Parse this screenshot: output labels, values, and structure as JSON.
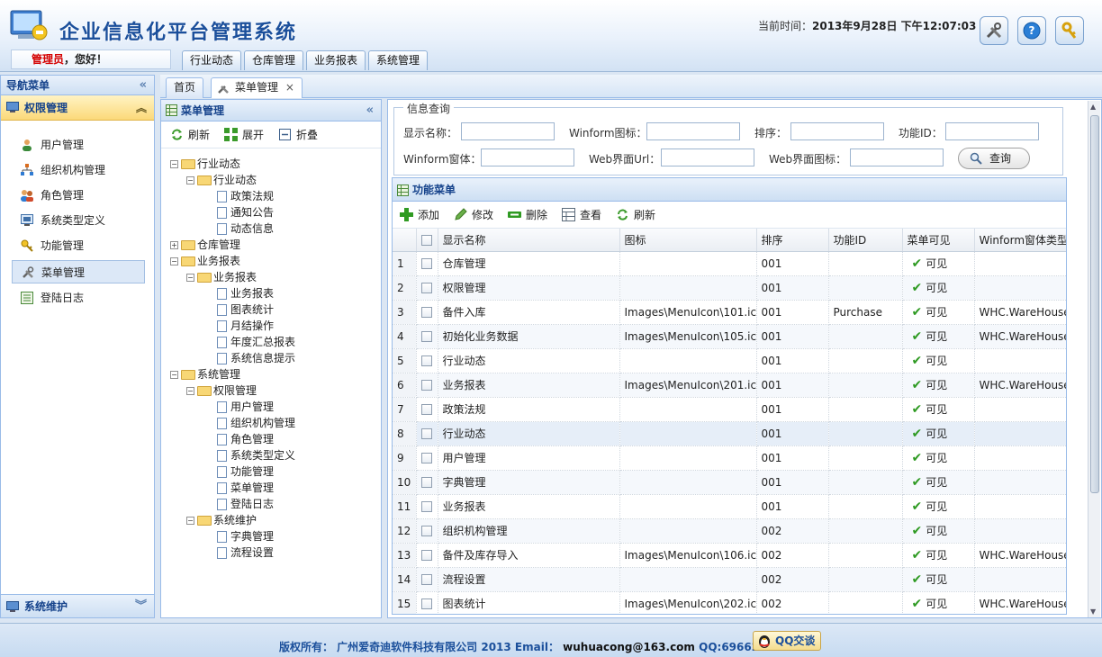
{
  "header": {
    "app_title": "企业信息化平台管理系统",
    "time_label": "当前时间：",
    "time_value": "2013年9月28日 下午12:07:03",
    "user_role": "管理员",
    "user_greeting": "，您好！",
    "top_tabs": [
      "行业动态",
      "仓库管理",
      "业务报表",
      "系统管理"
    ],
    "buttons": [
      {
        "name": "tools-icon"
      },
      {
        "name": "help-icon"
      },
      {
        "name": "exit-icon"
      }
    ]
  },
  "nav": {
    "title": "导航菜单",
    "section": "权限管理",
    "items": [
      {
        "label": "用户管理",
        "icon": "user-icon"
      },
      {
        "label": "组织机构管理",
        "icon": "org-icon"
      },
      {
        "label": "角色管理",
        "icon": "role-icon"
      },
      {
        "label": "系统类型定义",
        "icon": "system-type-icon"
      },
      {
        "label": "功能管理",
        "icon": "key-icon"
      },
      {
        "label": "菜单管理",
        "icon": "tools-icon",
        "selected": true
      },
      {
        "label": "登陆日志",
        "icon": "log-icon"
      }
    ],
    "bottom_section": "系统维护"
  },
  "workspace_tabs": [
    "首页",
    "菜单管理"
  ],
  "tree_panel": {
    "title": "菜单管理",
    "toolbar": [
      "刷新",
      "展开",
      "折叠"
    ],
    "nodes": [
      {
        "label": "行业动态",
        "level": 0,
        "type": "folder",
        "toggle": "-"
      },
      {
        "label": "行业动态",
        "level": 1,
        "type": "folder",
        "toggle": "-"
      },
      {
        "label": "政策法规",
        "level": 2,
        "type": "doc"
      },
      {
        "label": "通知公告",
        "level": 2,
        "type": "doc"
      },
      {
        "label": "动态信息",
        "level": 2,
        "type": "doc"
      },
      {
        "label": "仓库管理",
        "level": 0,
        "type": "folder",
        "toggle": "+"
      },
      {
        "label": "业务报表",
        "level": 0,
        "type": "folder",
        "toggle": "-"
      },
      {
        "label": "业务报表",
        "level": 1,
        "type": "folder",
        "toggle": "-"
      },
      {
        "label": "业务报表",
        "level": 2,
        "type": "doc"
      },
      {
        "label": "图表统计",
        "level": 2,
        "type": "doc"
      },
      {
        "label": "月结操作",
        "level": 2,
        "type": "doc"
      },
      {
        "label": "年度汇总报表",
        "level": 2,
        "type": "doc"
      },
      {
        "label": "系统信息提示",
        "level": 2,
        "type": "doc"
      },
      {
        "label": "系统管理",
        "level": 0,
        "type": "folder",
        "toggle": "-"
      },
      {
        "label": "权限管理",
        "level": 1,
        "type": "folder",
        "toggle": "-"
      },
      {
        "label": "用户管理",
        "level": 2,
        "type": "doc"
      },
      {
        "label": "组织机构管理",
        "level": 2,
        "type": "doc"
      },
      {
        "label": "角色管理",
        "level": 2,
        "type": "doc"
      },
      {
        "label": "系统类型定义",
        "level": 2,
        "type": "doc"
      },
      {
        "label": "功能管理",
        "level": 2,
        "type": "doc"
      },
      {
        "label": "菜单管理",
        "level": 2,
        "type": "doc"
      },
      {
        "label": "登陆日志",
        "level": 2,
        "type": "doc"
      },
      {
        "label": "系统维护",
        "level": 1,
        "type": "folder",
        "toggle": "-"
      },
      {
        "label": "字典管理",
        "level": 2,
        "type": "doc"
      },
      {
        "label": "流程设置",
        "level": 2,
        "type": "doc"
      }
    ]
  },
  "query": {
    "legend": "信息查询",
    "fields": [
      {
        "label": "显示名称：",
        "value": ""
      },
      {
        "label": "Winform图标：",
        "value": ""
      },
      {
        "label": "排序：",
        "value": ""
      },
      {
        "label": "功能ID：",
        "value": ""
      },
      {
        "label": "Winform窗体：",
        "value": ""
      },
      {
        "label": "Web界面Url：",
        "value": ""
      },
      {
        "label": "Web界面图标：",
        "value": ""
      }
    ],
    "button": "查询"
  },
  "grid": {
    "title": "功能菜单",
    "toolbar": [
      "添加",
      "修改",
      "删除",
      "查看",
      "刷新"
    ],
    "columns": [
      "显示名称",
      "图标",
      "排序",
      "功能ID",
      "菜单可见",
      "Winform窗体类型"
    ],
    "rows": [
      {
        "n": "1",
        "name": "仓库管理",
        "icon": "",
        "sort": "001",
        "fid": "",
        "visible": "可见",
        "winform": ""
      },
      {
        "n": "2",
        "name": "权限管理",
        "icon": "",
        "sort": "001",
        "fid": "",
        "visible": "可见",
        "winform": ""
      },
      {
        "n": "3",
        "name": "备件入库",
        "icon": "Images\\MenuIcon\\101.ico",
        "sort": "001",
        "fid": "Purchase",
        "visible": "可见",
        "winform": "WHC.WareHouse"
      },
      {
        "n": "4",
        "name": "初始化业务数据",
        "icon": "Images\\MenuIcon\\105.ico",
        "sort": "001",
        "fid": "",
        "visible": "可见",
        "winform": "WHC.WareHouse"
      },
      {
        "n": "5",
        "name": "行业动态",
        "icon": "",
        "sort": "001",
        "fid": "",
        "visible": "可见",
        "winform": ""
      },
      {
        "n": "6",
        "name": "业务报表",
        "icon": "Images\\MenuIcon\\201.ico",
        "sort": "001",
        "fid": "",
        "visible": "可见",
        "winform": "WHC.WareHouse"
      },
      {
        "n": "7",
        "name": "政策法规",
        "icon": "",
        "sort": "001",
        "fid": "",
        "visible": "可见",
        "winform": ""
      },
      {
        "n": "8",
        "name": "行业动态",
        "icon": "",
        "sort": "001",
        "fid": "",
        "visible": "可见",
        "winform": "",
        "highlight": true
      },
      {
        "n": "9",
        "name": "用户管理",
        "icon": "",
        "sort": "001",
        "fid": "",
        "visible": "可见",
        "winform": ""
      },
      {
        "n": "10",
        "name": "字典管理",
        "icon": "",
        "sort": "001",
        "fid": "",
        "visible": "可见",
        "winform": ""
      },
      {
        "n": "11",
        "name": "业务报表",
        "icon": "",
        "sort": "001",
        "fid": "",
        "visible": "可见",
        "winform": ""
      },
      {
        "n": "12",
        "name": "组织机构管理",
        "icon": "",
        "sort": "002",
        "fid": "",
        "visible": "可见",
        "winform": ""
      },
      {
        "n": "13",
        "name": "备件及库存导入",
        "icon": "Images\\MenuIcon\\106.ico",
        "sort": "002",
        "fid": "",
        "visible": "可见",
        "winform": "WHC.WareHouse"
      },
      {
        "n": "14",
        "name": "流程设置",
        "icon": "",
        "sort": "002",
        "fid": "",
        "visible": "可见",
        "winform": ""
      },
      {
        "n": "15",
        "name": "图表统计",
        "icon": "Images\\MenuIcon\\202.ico",
        "sort": "002",
        "fid": "",
        "visible": "可见",
        "winform": "WHC.WareHouse"
      }
    ]
  },
  "footer": {
    "copyright": "版权所有： 广州爱奇迪软件科技有限公司 2013 Email：",
    "email": "wuhuacong@163.com",
    "qq": "QQ:6966254",
    "qq_button": "QQ交谈"
  }
}
